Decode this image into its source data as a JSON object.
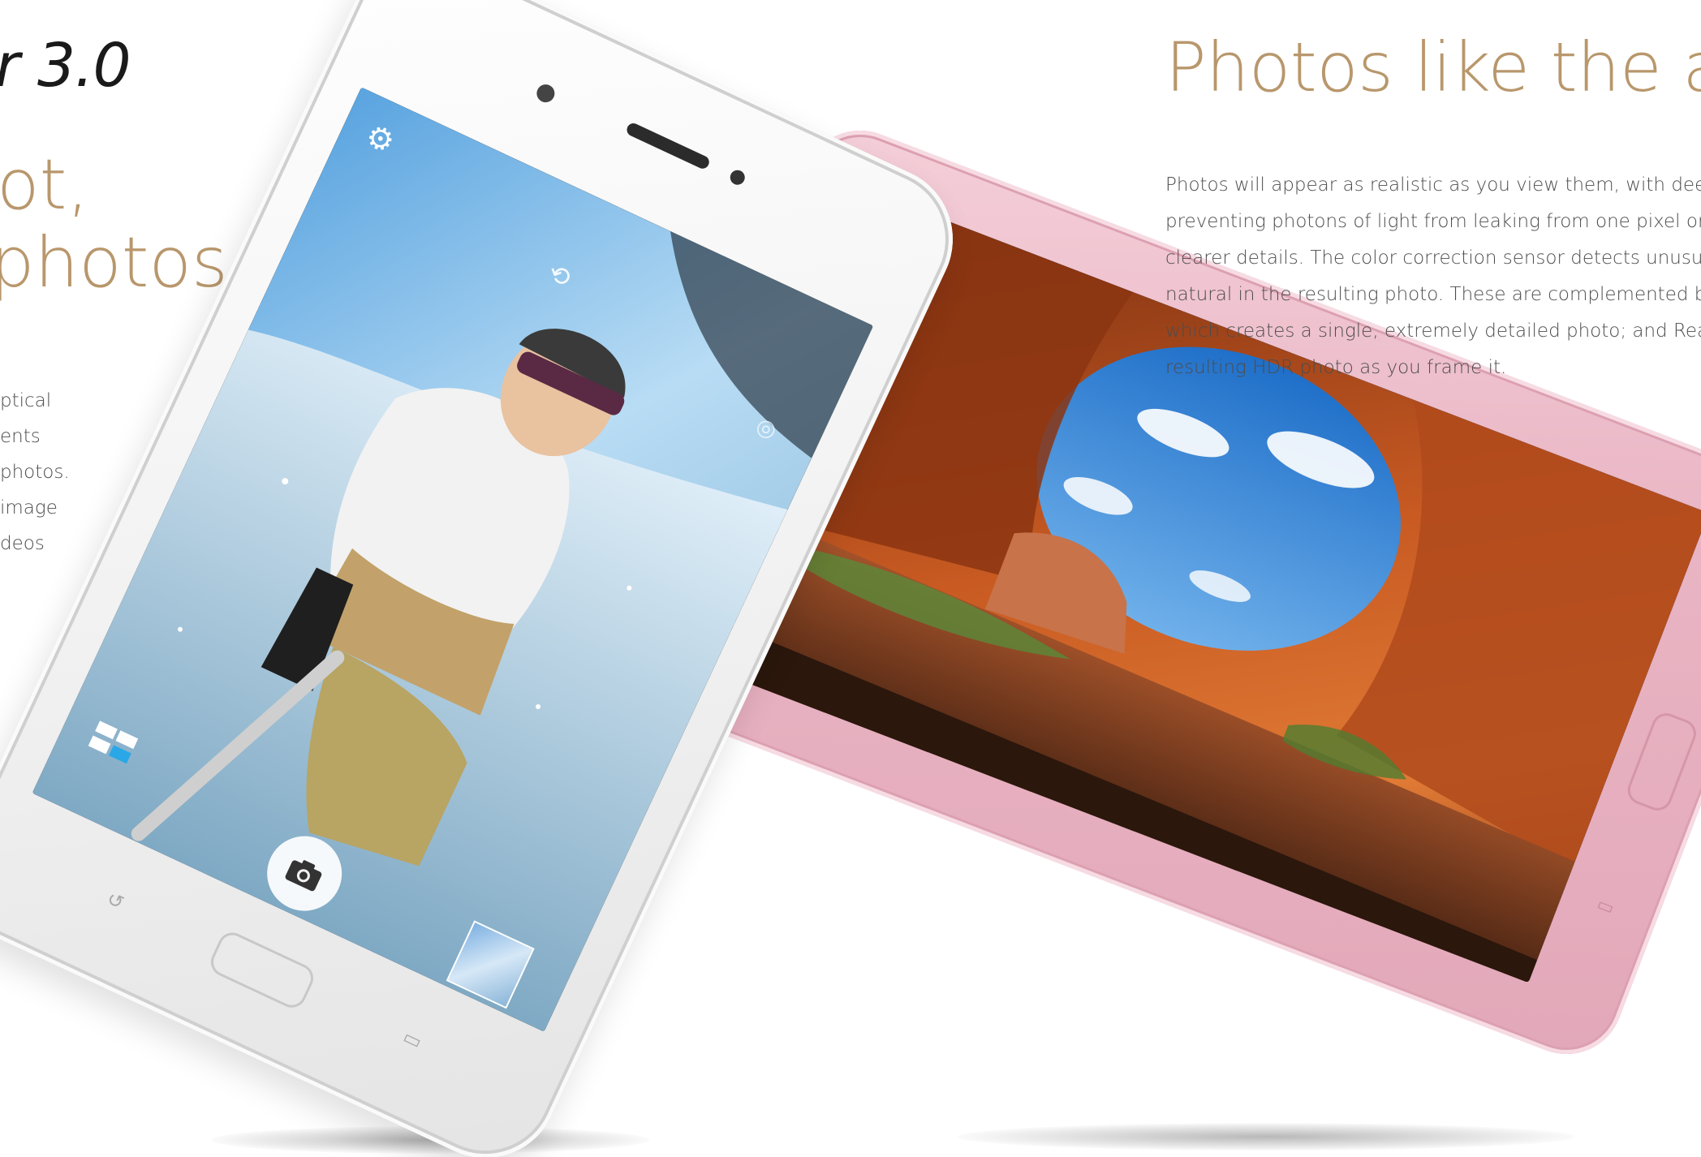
{
  "left_column": {
    "brand_mark": "r 3.0",
    "headline_lines": [
      "ot,",
      "photos"
    ],
    "body_lines": [
      "ptical",
      "ents",
      "photos.",
      "image",
      "deos"
    ]
  },
  "right_column": {
    "title": "Photos like the act",
    "body_lines": [
      "Photos will appear as realistic as you view them, with deep",
      "preventing photons of light from leaking from one pixel or",
      "clearer details. The color correction sensor detects unusua",
      "natural in the resulting photo. These are complemented b",
      "which creates a single, extremely detailed photo; and Real",
      "resulting HDR photo as you frame it."
    ]
  },
  "devices": {
    "pink_phone_color": "#e9b4c3",
    "white_phone_color": "#f4f4f4",
    "accent_color": "#b8976c"
  },
  "camera_ui": {
    "settings_icon": "gear-icon",
    "switch_camera_icon": "camera-switch-icon",
    "timer_icon": "timer-icon",
    "modes_icon": "grid-modes-icon",
    "shutter_icon": "camera-shutter-icon",
    "gallery_icon": "gallery-thumbnail"
  }
}
